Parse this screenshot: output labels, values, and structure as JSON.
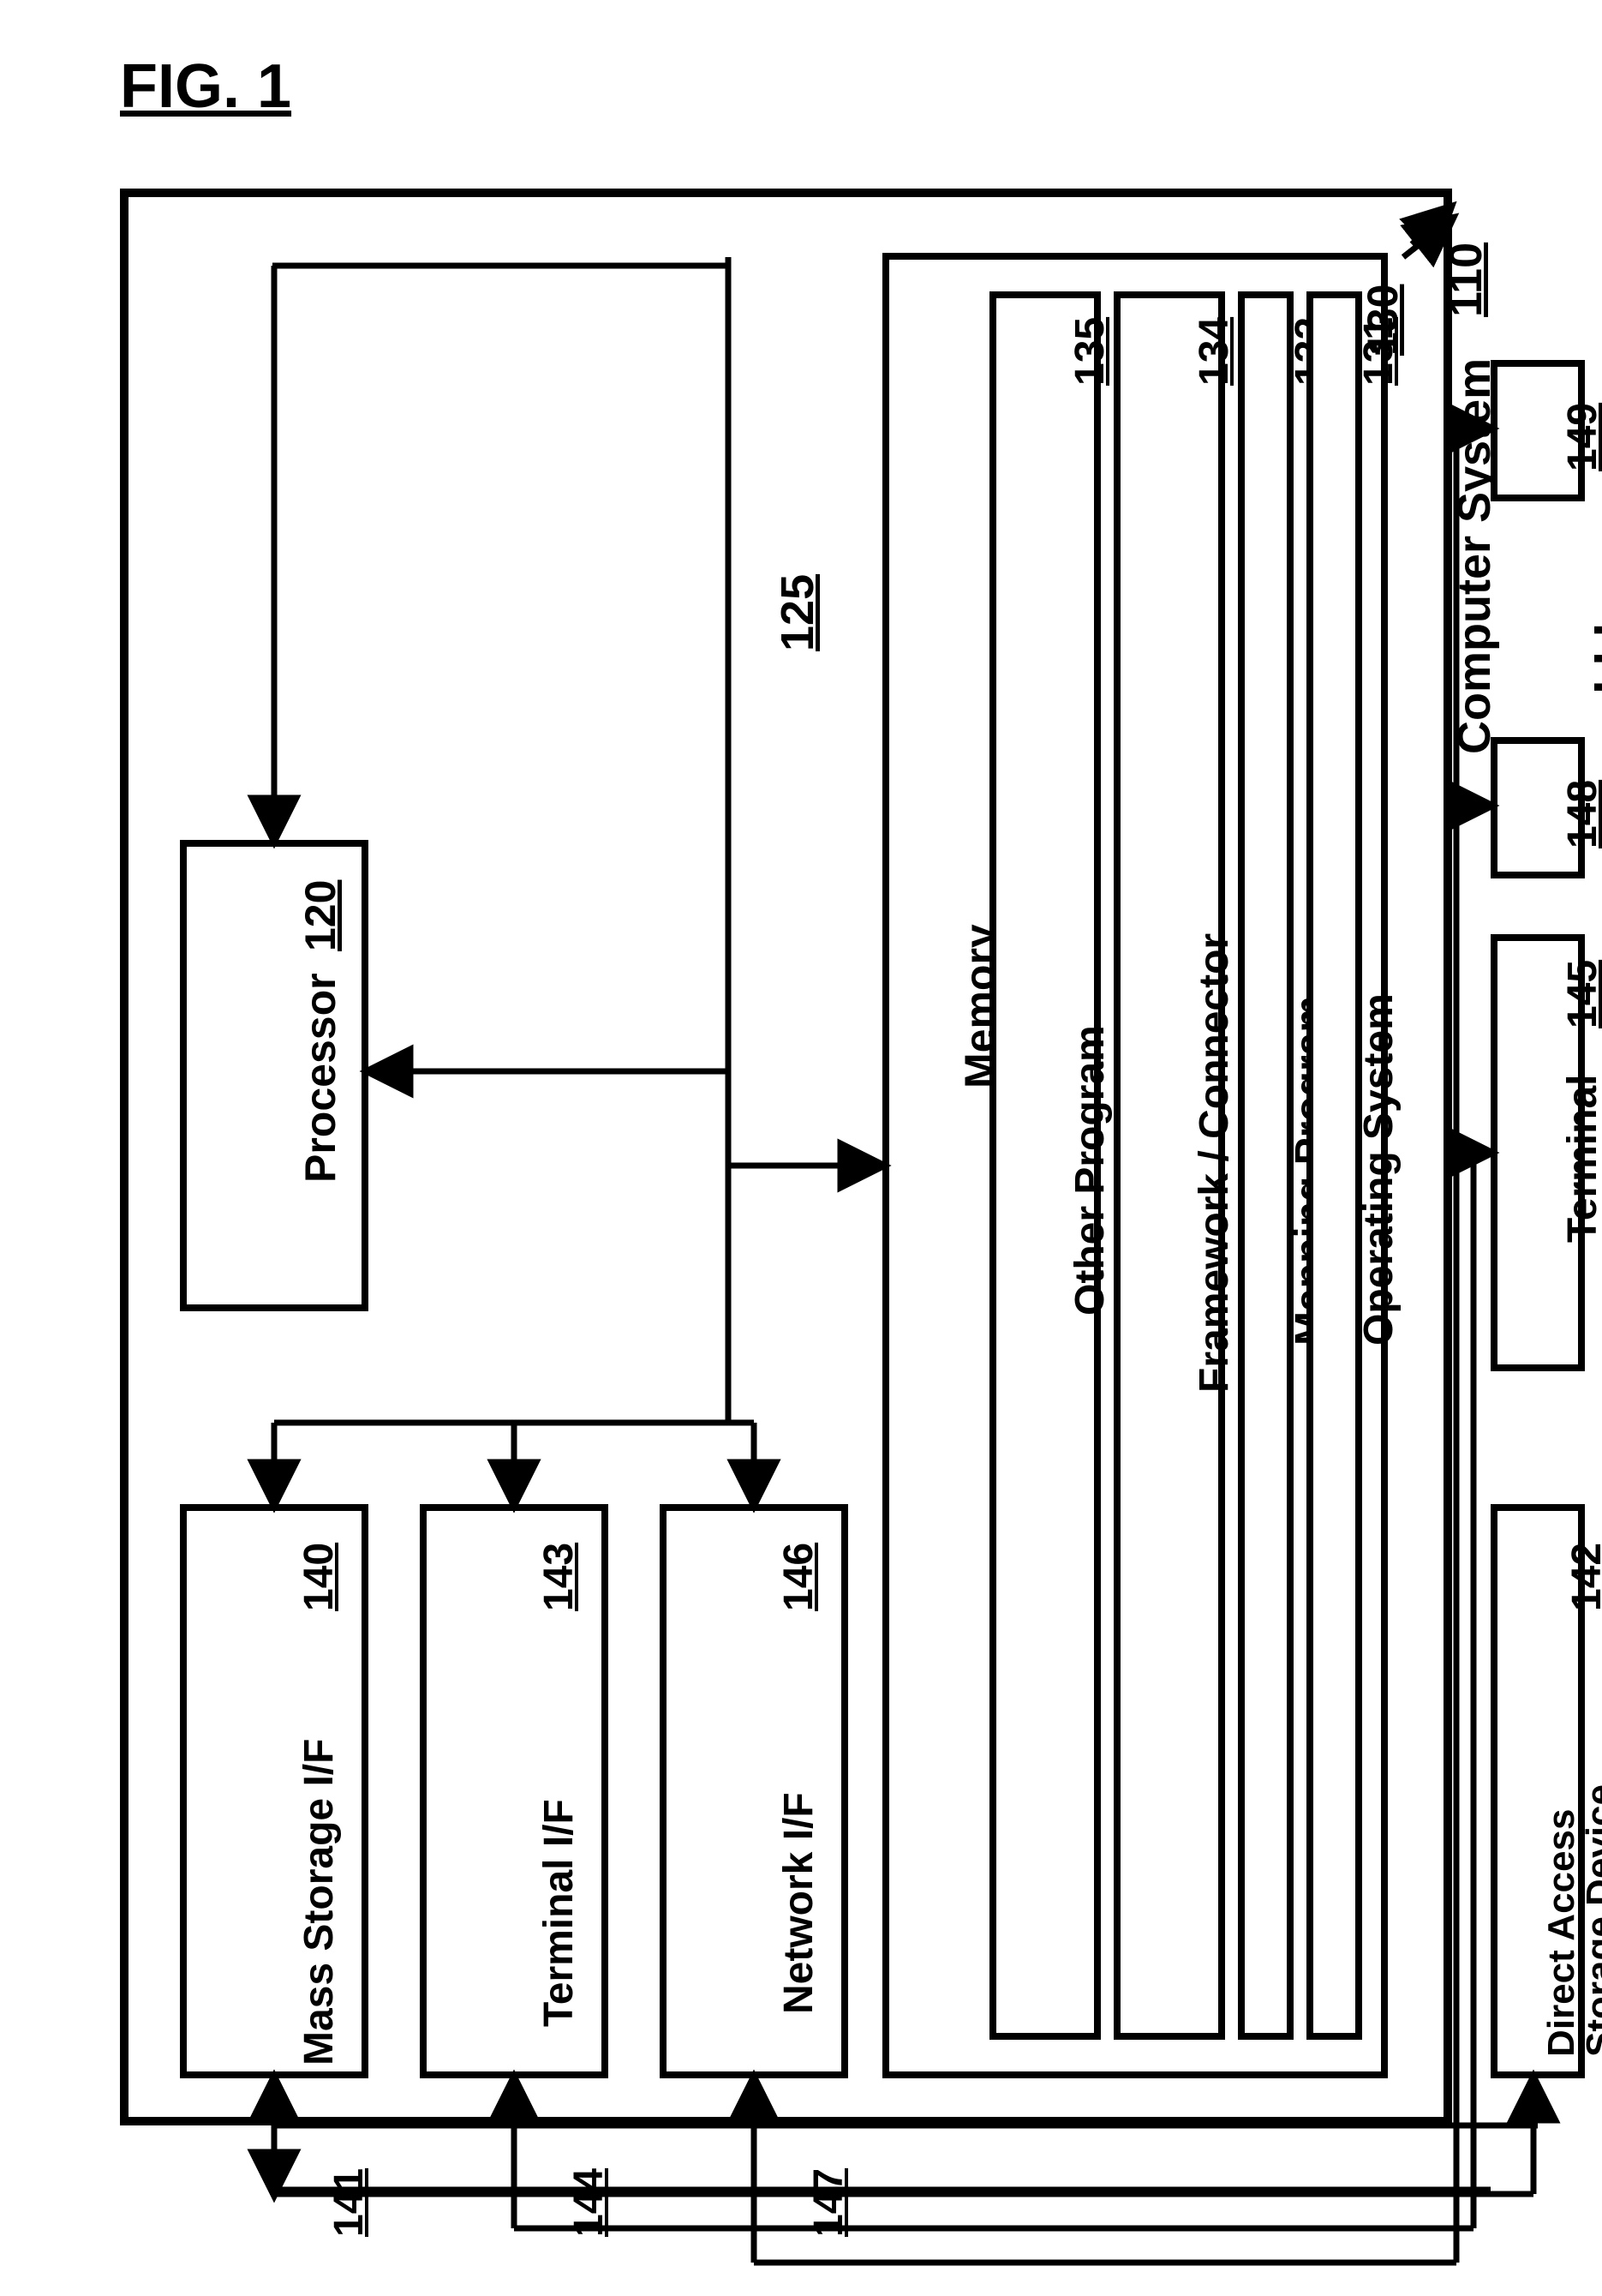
{
  "figure_label": "FIG. 1",
  "system": {
    "label": "Computer System",
    "ref": "110"
  },
  "bus_ref": "125",
  "processor": {
    "label": "Processor",
    "ref": "120"
  },
  "memory": {
    "label": "Memory",
    "ref": "130",
    "other": {
      "label": "Other Program",
      "ref": "135"
    },
    "framework": {
      "label": "Framework / Connector",
      "ref": "134"
    },
    "mapping": {
      "label": "Mapping Program",
      "ref": "132"
    },
    "os": {
      "label": "Operating System",
      "ref": "131"
    }
  },
  "mass_if": {
    "label": "Mass Storage I/F",
    "ref": "140"
  },
  "term_if": {
    "label": "Terminal I/F",
    "ref": "143"
  },
  "net_if": {
    "label": "Network I/F",
    "ref": "146"
  },
  "dasd": {
    "label": "Direct Access\nStorage Device",
    "ref": "142"
  },
  "terminal": {
    "label": "Terminal",
    "ref": "145"
  },
  "net_a_ref": "148",
  "net_b_ref": "149",
  "conn_141": "141",
  "conn_144": "144",
  "conn_147": "147",
  "ellipsis": ". . ."
}
